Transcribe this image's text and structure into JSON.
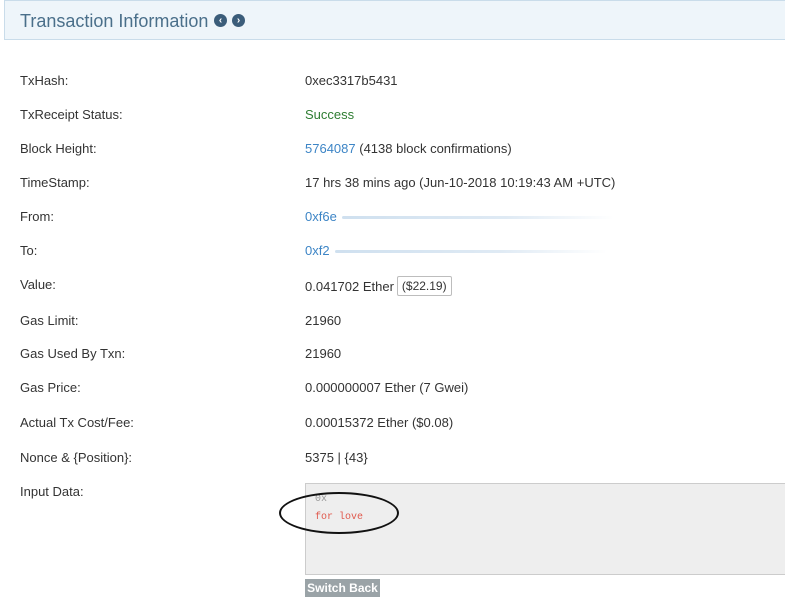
{
  "header": {
    "title": "Transaction Information",
    "prev_icon": "chevron-left-circle-icon",
    "next_icon": "chevron-right-circle-icon"
  },
  "rows": {
    "txhash": {
      "label": "TxHash:",
      "value": "0xec3317b5431"
    },
    "status": {
      "label": "TxReceipt Status:",
      "value": "Success"
    },
    "block": {
      "label": "Block Height:",
      "link": "5764087",
      "suffix": "(4138 block confirmations)"
    },
    "timestamp": {
      "label": "TimeStamp:",
      "value": "17 hrs 38 mins ago (Jun-10-2018 10:19:43 AM +UTC)"
    },
    "from": {
      "label": "From:",
      "value": "0xf6e"
    },
    "to": {
      "label": "To:",
      "value": "0xf2"
    },
    "value": {
      "label": "Value:",
      "amount": "0.041702 Ether",
      "usd": "($22.19)"
    },
    "gas_limit": {
      "label": "Gas Limit:",
      "value": "21960"
    },
    "gas_used": {
      "label": "Gas Used By Txn:",
      "value": "21960"
    },
    "gas_price": {
      "label": "Gas Price:",
      "value": "0.000000007 Ether (7 Gwei)"
    },
    "fee": {
      "label": "Actual Tx Cost/Fee:",
      "value": "0.00015372 Ether ($0.08)"
    },
    "nonce": {
      "label": "Nonce & {Position}:",
      "value": "5375 | {43}"
    },
    "input": {
      "label": "Input Data:",
      "line1": "0x",
      "line2": "for love"
    }
  },
  "switch_button": "Switch Back",
  "colors": {
    "link": "#3d85c6",
    "success": "#2e7d32",
    "input_text": "#e0594d",
    "header_bg": "#eef5fa"
  }
}
